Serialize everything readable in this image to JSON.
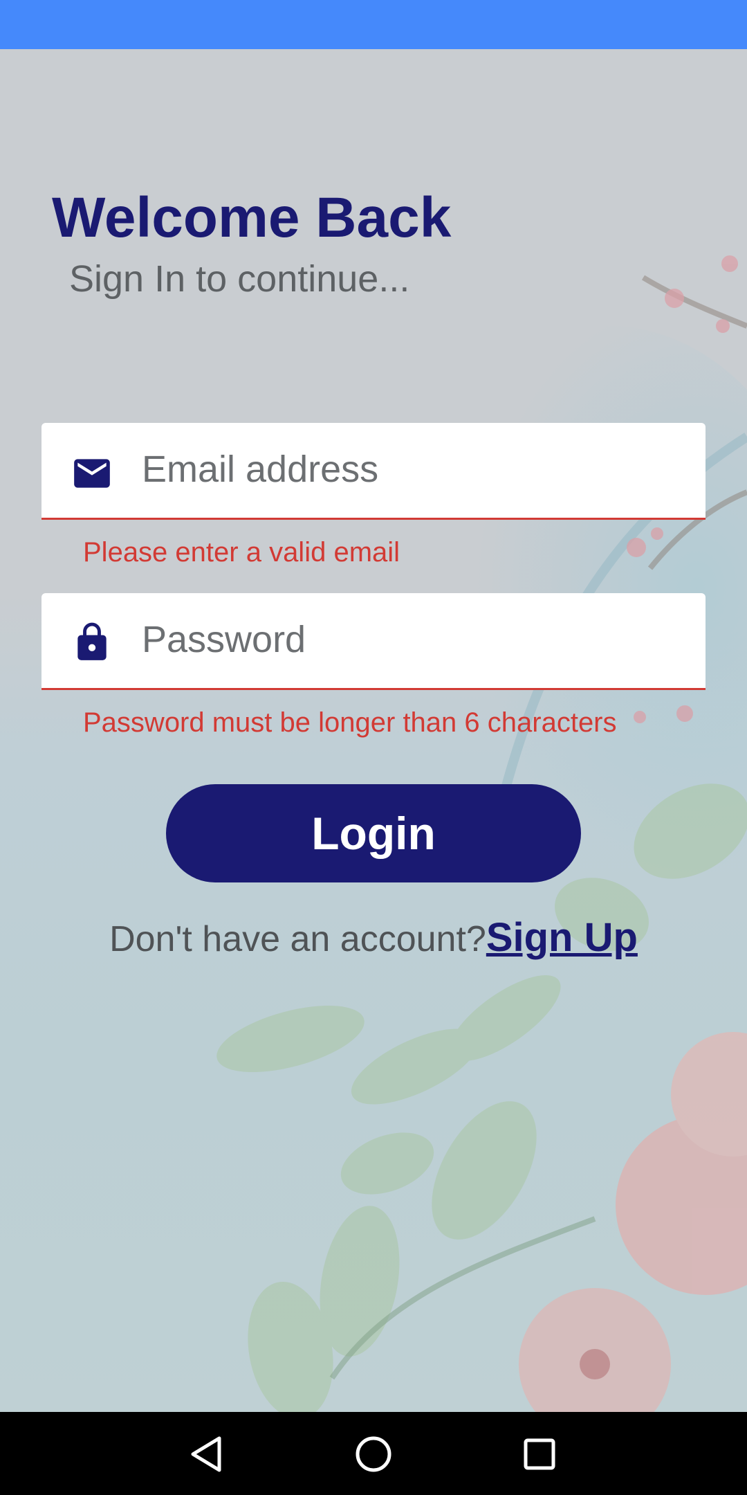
{
  "colors": {
    "status_bar": "#4589fb",
    "brand": "#1a1a72",
    "error": "#d23a34",
    "nav_bar": "#000000"
  },
  "header": {
    "title": "Welcome Back",
    "subtitle": "Sign In to continue..."
  },
  "form": {
    "email": {
      "placeholder": "Email address",
      "value": "",
      "icon": "mail-icon",
      "error": "Please enter a valid email"
    },
    "password": {
      "placeholder": "Password",
      "value": "",
      "icon": "lock-icon",
      "error": "Password must be longer than 6 characters"
    },
    "login_label": "Login"
  },
  "signup": {
    "prompt": "Don't have an account?",
    "link_label": "Sign Up"
  },
  "nav": {
    "icons": [
      "back-icon",
      "home-icon",
      "recents-icon"
    ]
  }
}
